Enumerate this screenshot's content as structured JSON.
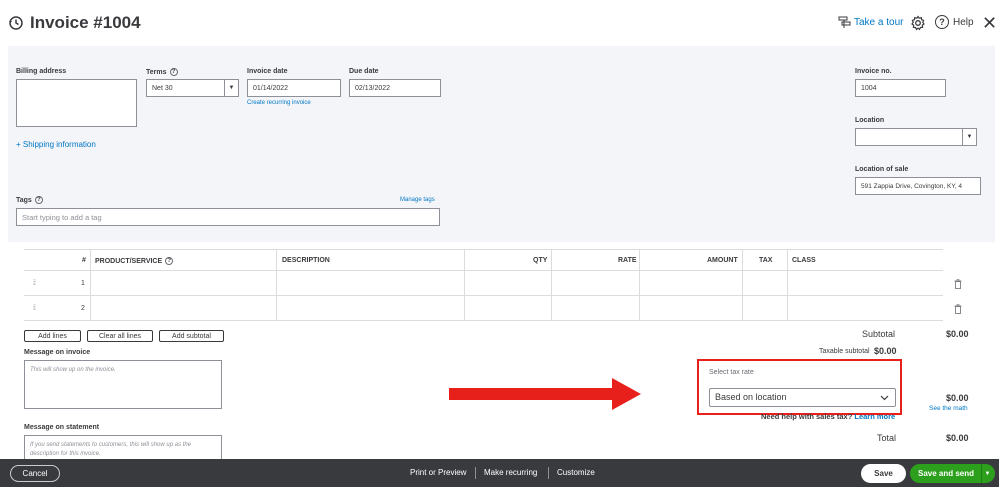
{
  "header": {
    "title": "Invoice #1004",
    "take_tour": "Take a tour",
    "help": "Help"
  },
  "form": {
    "billing_address_label": "Billing address",
    "terms_label": "Terms",
    "terms_value": "Net 30",
    "invoice_date_label": "Invoice date",
    "invoice_date_value": "01/14/2022",
    "due_date_label": "Due date",
    "due_date_value": "02/13/2022",
    "create_recurring": "Create recurring invoice",
    "shipping_info": "+ Shipping information",
    "invoice_no_label": "Invoice no.",
    "invoice_no_value": "1004",
    "location_label": "Location",
    "location_value": "",
    "location_of_sale_label": "Location of sale",
    "location_of_sale_value": "591 Zappia Drive, Covington, KY, 4",
    "tags_label": "Tags",
    "manage_tags": "Manage tags",
    "tags_placeholder": "Start typing to add a tag"
  },
  "table": {
    "headers": [
      "#",
      "PRODUCT/SERVICE",
      "DESCRIPTION",
      "QTY",
      "RATE",
      "AMOUNT",
      "TAX",
      "CLASS"
    ],
    "rows": [
      {
        "num": "1"
      },
      {
        "num": "2"
      }
    ]
  },
  "actions": {
    "add_lines": "Add lines",
    "clear_all_lines": "Clear all lines",
    "add_subtotal": "Add subtotal"
  },
  "messages": {
    "invoice_label": "Message on invoice",
    "invoice_placeholder": "This will show up on the invoice.",
    "statement_label": "Message on statement",
    "statement_placeholder": "If you send statements to customers, this will show up as the description for this invoice."
  },
  "totals": {
    "subtotal_label": "Subtotal",
    "subtotal_value": "$0.00",
    "taxable_label": "Taxable subtotal",
    "taxable_value": "$0.00",
    "tax_value": "$0.00",
    "see_math": "See the math",
    "help_tax": "Need help with sales tax?",
    "learn_more": "Learn more",
    "total_label": "Total",
    "total_value": "$0.00"
  },
  "tax_rate": {
    "label": "Select tax rate",
    "value": "Based on location"
  },
  "footer": {
    "cancel": "Cancel",
    "print_preview": "Print or Preview",
    "make_recurring": "Make recurring",
    "customize": "Customize",
    "save": "Save",
    "save_and_send": "Save and send"
  },
  "colors": {
    "accent_blue": "#0077c5",
    "green": "#2ca01c",
    "highlight_red": "#e8201b",
    "footer_bg": "#393a3d"
  }
}
